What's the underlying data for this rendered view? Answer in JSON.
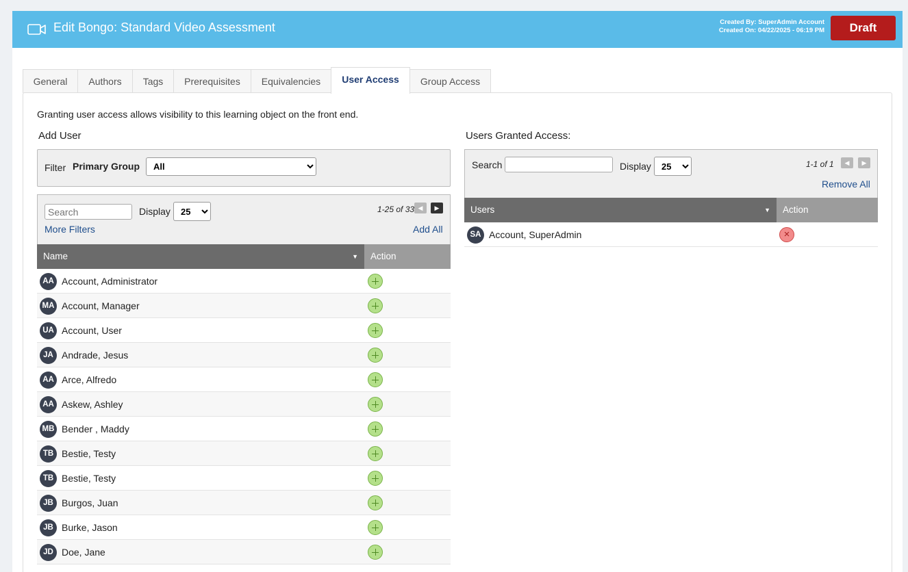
{
  "header": {
    "title": "Edit Bongo: Standard Video Assessment",
    "created_by": "Created By: SuperAdmin Account",
    "created_on": "Created On: 04/22/2025 - 06:19 PM",
    "status_button": "Draft",
    "colors": {
      "bar": "#5abbe8",
      "draft": "#b41c1c"
    },
    "icon": "video-camera-icon"
  },
  "tabs": [
    {
      "label": "General"
    },
    {
      "label": "Authors"
    },
    {
      "label": "Tags"
    },
    {
      "label": "Prerequisites"
    },
    {
      "label": "Equivalencies"
    },
    {
      "label": "User Access",
      "active": true
    },
    {
      "label": "Group Access"
    }
  ],
  "intro": "Granting user access allows visibility to this learning object on the front end.",
  "add_user": {
    "title": "Add User",
    "filter_label": "Filter",
    "primary_group_label": "Primary Group",
    "primary_group_value": "All",
    "search_placeholder": "Search",
    "display_label": "Display",
    "display_value": "25",
    "page_count": "1-25 of 33",
    "more_filters": "More Filters",
    "add_all": "Add All",
    "col_name": "Name",
    "col_action": "Action",
    "rows": [
      {
        "initials": "AA",
        "name": "Account, Administrator"
      },
      {
        "initials": "MA",
        "name": "Account, Manager"
      },
      {
        "initials": "UA",
        "name": "Account, User"
      },
      {
        "initials": "JA",
        "name": "Andrade, Jesus"
      },
      {
        "initials": "AA",
        "name": "Arce, Alfredo"
      },
      {
        "initials": "AA",
        "name": "Askew, Ashley"
      },
      {
        "initials": "MB",
        "name": "Bender , Maddy"
      },
      {
        "initials": "TB",
        "name": "Bestie, Testy"
      },
      {
        "initials": "TB",
        "name": "Bestie, Testy"
      },
      {
        "initials": "JB",
        "name": "Burgos, Juan"
      },
      {
        "initials": "JB",
        "name": "Burke, Jason"
      },
      {
        "initials": "JD",
        "name": "Doe, Jane"
      }
    ]
  },
  "granted": {
    "title": "Users Granted Access:",
    "search_label": "Search",
    "search_value": "",
    "display_label": "Display",
    "display_value": "25",
    "page_count": "1-1 of 1",
    "remove_all": "Remove All",
    "col_users": "Users",
    "col_action": "Action",
    "rows": [
      {
        "initials": "SA",
        "name": "Account, SuperAdmin"
      }
    ]
  }
}
